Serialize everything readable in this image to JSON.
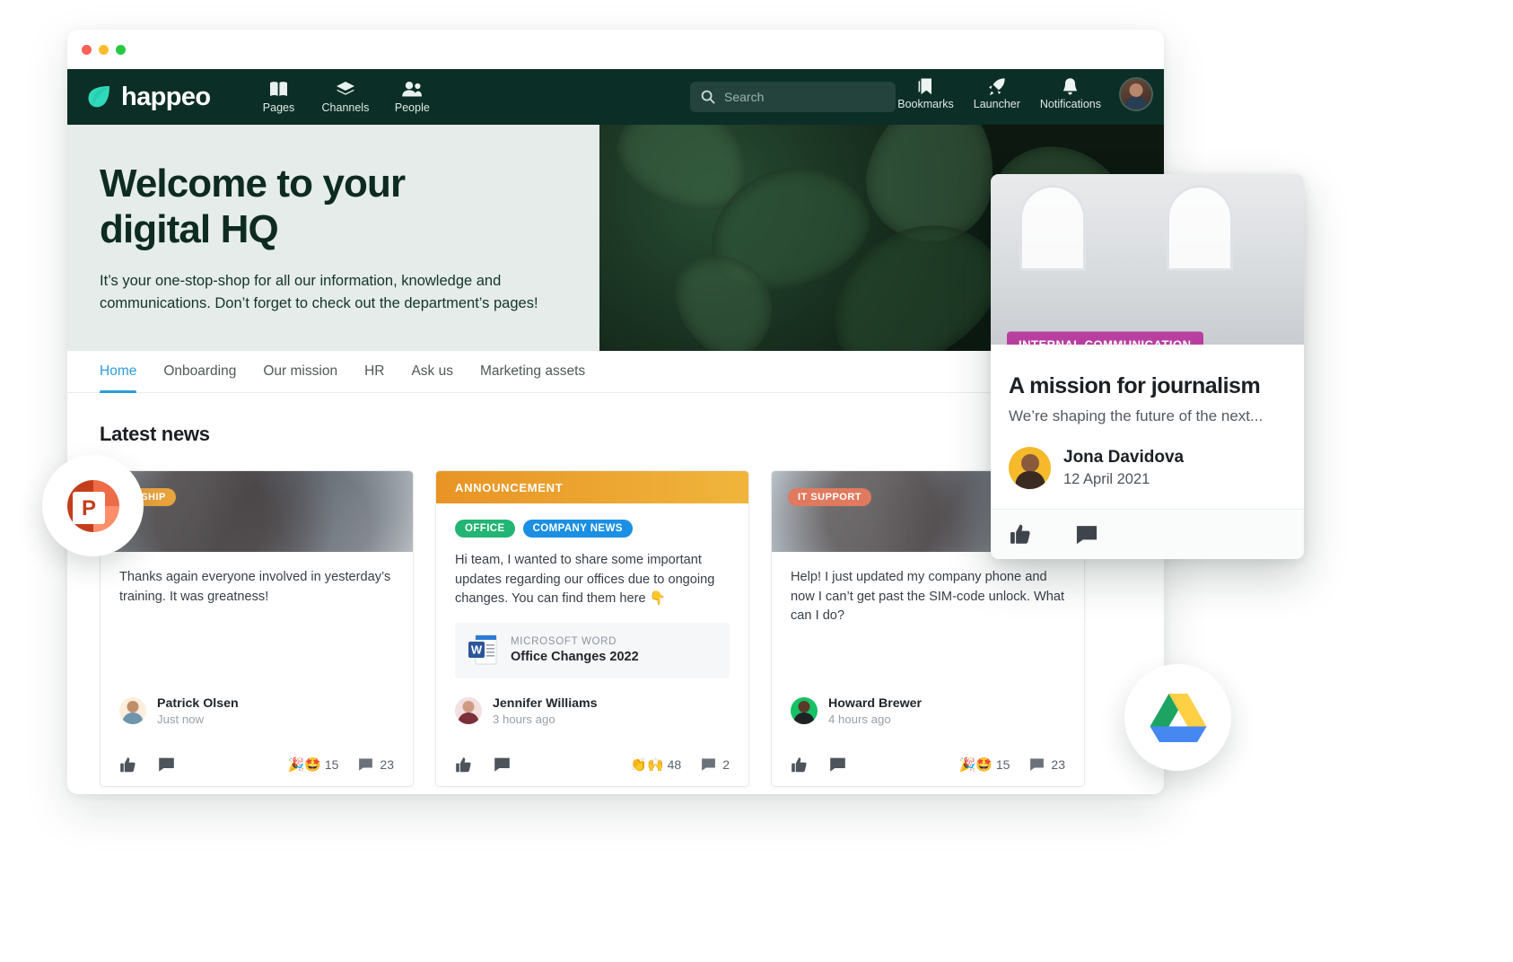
{
  "window": {
    "traffic_lights": [
      "close",
      "minimize",
      "maximize"
    ]
  },
  "topnav": {
    "brand": "happeo",
    "brand_logo_icon": "happeo-leaf-logo-icon",
    "items": [
      {
        "label": "Pages",
        "icon": "book-icon"
      },
      {
        "label": "Channels",
        "icon": "layers-icon"
      },
      {
        "label": "People",
        "icon": "people-icon"
      }
    ],
    "search": {
      "placeholder": "Search",
      "value": "",
      "icon": "search-icon"
    },
    "right_items": [
      {
        "label": "Bookmarks",
        "icon": "bookmark-icon"
      },
      {
        "label": "Launcher",
        "icon": "rocket-icon"
      },
      {
        "label": "Notifications",
        "icon": "bell-icon"
      }
    ],
    "avatar_icon": "user-avatar",
    "background_color": "#0b2e26"
  },
  "hero": {
    "title_line1": "Welcome to your",
    "title_line2": "digital HQ",
    "body_line1": "It’s your one-stop-shop for all our information, knowledge and",
    "body_line2": "communications. Don’t forget to check out the department’s pages!",
    "background_color": "#e5ecea"
  },
  "tabs": {
    "active_color": "#2d9cdb",
    "items": [
      {
        "label": "Home",
        "active": true
      },
      {
        "label": "Onboarding",
        "active": false
      },
      {
        "label": "Our mission",
        "active": false
      },
      {
        "label": "HR",
        "active": false
      },
      {
        "label": "Ask us",
        "active": false
      },
      {
        "label": "Marketing assets",
        "active": false
      }
    ]
  },
  "main": {
    "section_title": "Latest news",
    "cards": [
      {
        "badge": {
          "label": "LEADERSHIP",
          "color": "#e8a33d"
        },
        "text": "Thanks again everyone involved in yesterday’s training. It was greatness!",
        "author": {
          "name": "Patrick Olsen",
          "time": "Just now"
        },
        "footer": {
          "like_icon": "thumbs-up-icon",
          "comment_icon": "comment-icon",
          "reaction_emojis": "🎉🤩",
          "reaction_count": "15",
          "comment_count": "23"
        }
      },
      {
        "banner": {
          "label": "ANNOUNCEMENT",
          "color": "#e79a2b"
        },
        "tags": [
          {
            "label": "OFFICE",
            "color": "#22b573"
          },
          {
            "label": "COMPANY NEWS",
            "color": "#1a8fe3"
          }
        ],
        "text": "Hi team, I wanted to share some important updates regarding our offices due to ongoing changes. You can find them here 👇",
        "attachment": {
          "icon": "microsoft-word-icon",
          "kicker": "MICROSOFT WORD",
          "name": "Office Changes 2022"
        },
        "author": {
          "name": "Jennifer Williams",
          "time": "3 hours ago"
        },
        "footer": {
          "like_icon": "thumbs-up-icon",
          "comment_icon": "comment-icon",
          "reaction_emojis": "👏🙌",
          "reaction_count": "48",
          "comment_count": "2"
        }
      },
      {
        "badge": {
          "label": "IT SUPPORT",
          "color": "#e07a5f"
        },
        "text": "Help! I just updated my company phone and now I can’t get past the SIM-code unlock. What can I do?",
        "author": {
          "name": "Howard Brewer",
          "time": "4 hours ago"
        },
        "footer": {
          "like_icon": "thumbs-up-icon",
          "comment_icon": "comment-icon",
          "reaction_emojis": "🎉🤩",
          "reaction_count": "15",
          "comment_count": "23"
        }
      }
    ]
  },
  "float_card": {
    "badge": {
      "label": "INTERNAL COMMUNICATION",
      "color": "#b83fa0"
    },
    "title": "A mission for journalism",
    "subtitle": "We’re shaping the future of the next...",
    "author": {
      "name": "Jona Davidova",
      "date": "12 April 2021"
    },
    "actions": [
      {
        "icon": "thumbs-up-icon"
      },
      {
        "icon": "comment-icon"
      }
    ]
  },
  "bubbles": [
    {
      "name": "powerpoint-icon"
    },
    {
      "name": "google-drive-icon"
    }
  ]
}
